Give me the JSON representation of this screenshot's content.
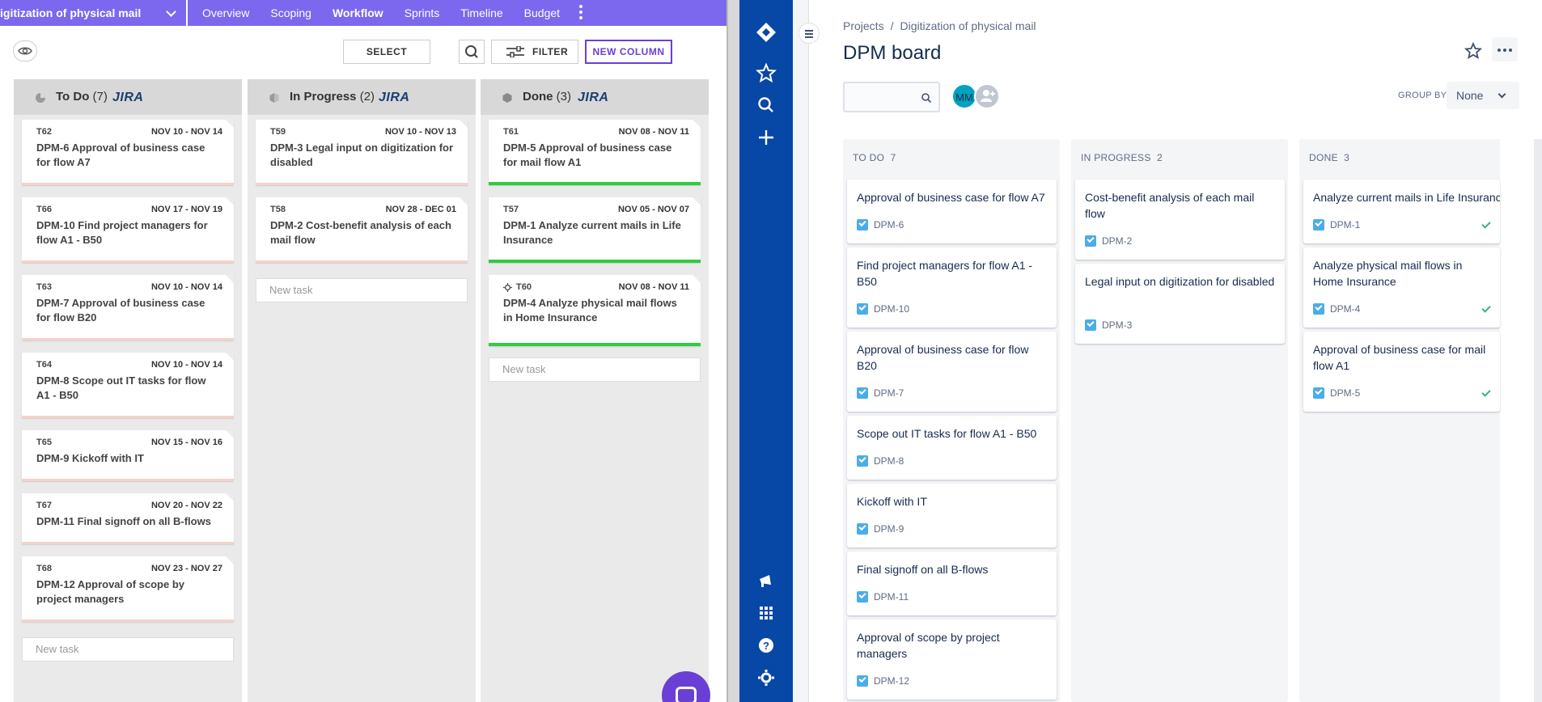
{
  "left_app": {
    "project_name": "igitization of physical mail",
    "nav": [
      "Overview",
      "Scoping",
      "Workflow",
      "Sprints",
      "Timeline",
      "Budget"
    ],
    "active_nav": "Workflow",
    "toolbar": {
      "select_label": "SELECT",
      "filter_label": "FILTER",
      "new_column_label": "NEW COLUMN"
    },
    "new_task_placeholder": "New task",
    "jira_label": "JIRA",
    "columns": [
      {
        "name": "To Do",
        "count": "(7)",
        "cards": [
          {
            "id": "T62",
            "dates": "NOV 10 - NOV 14",
            "title": "DPM-6 Approval of business case for flow A7"
          },
          {
            "id": "T66",
            "dates": "NOV 17 - NOV 19",
            "title": "DPM-10 Find project managers for flow A1 - B50"
          },
          {
            "id": "T63",
            "dates": "NOV 10 - NOV 14",
            "title": "DPM-7 Approval of business case for flow B20"
          },
          {
            "id": "T64",
            "dates": "NOV 10 - NOV 14",
            "title": "DPM-8 Scope out IT tasks for flow A1 - B50"
          },
          {
            "id": "T65",
            "dates": "NOV 15 - NOV 16",
            "title": "DPM-9 Kickoff with IT"
          },
          {
            "id": "T67",
            "dates": "NOV 20 - NOV 22",
            "title": "DPM-11 Final signoff on all B-flows"
          },
          {
            "id": "T68",
            "dates": "NOV 23 - NOV 27",
            "title": "DPM-12 Approval of scope by project managers"
          }
        ]
      },
      {
        "name": "In Progress",
        "count": "(2)",
        "cards": [
          {
            "id": "T59",
            "dates": "NOV 10 - NOV 13",
            "title": "DPM-3 Legal input on digitization for disabled"
          },
          {
            "id": "T58",
            "dates": "NOV 28 - DEC 01",
            "title": "DPM-2 Cost-benefit analysis of each mail flow"
          }
        ]
      },
      {
        "name": "Done",
        "count": "(3)",
        "cards": [
          {
            "id": "T61",
            "dates": "NOV 08 - NOV 11",
            "title": "DPM-5 Approval of business case for mail flow A1"
          },
          {
            "id": "T57",
            "dates": "NOV 05 - NOV 07",
            "title": "DPM-1 Analyze current mails in Life Insurance"
          },
          {
            "id": "T60",
            "dates": "NOV 08 - NOV 11",
            "title": "DPM-4 Analyze physical mail flows in Home Insurance"
          }
        ]
      }
    ],
    "colors": {
      "accent": "#7b68ee",
      "todo_bar": "#f6d1cc",
      "done_bar": "#2ecc40"
    }
  },
  "jira": {
    "breadcrumb": [
      "Projects",
      "/",
      "Digitization of physical mail"
    ],
    "board_title": "DPM board",
    "avatar_initials": "MM",
    "group_by_label": "GROUP BY",
    "group_by_value": "None",
    "columns": [
      {
        "name": "TO DO",
        "count": "7",
        "cards": [
          {
            "title": "Approval of business case for flow A7",
            "key": "DPM-6"
          },
          {
            "title": "Find project managers for flow A1 - B50",
            "key": "DPM-10"
          },
          {
            "title": "Approval of business case for flow B20",
            "key": "DPM-7"
          },
          {
            "title": "Scope out IT tasks for flow A1 - B50",
            "key": "DPM-8"
          },
          {
            "title": "Kickoff with IT",
            "key": "DPM-9"
          },
          {
            "title": "Final signoff on all B-flows",
            "key": "DPM-11"
          },
          {
            "title": "Approval of scope by project managers",
            "key": "DPM-12"
          }
        ]
      },
      {
        "name": "IN PROGRESS",
        "count": "2",
        "cards": [
          {
            "title": "Cost-benefit analysis of each mail flow",
            "key": "DPM-2"
          },
          {
            "title": "Legal input on digitization for disabled",
            "key": "DPM-3"
          }
        ]
      },
      {
        "name": "DONE",
        "count": "3",
        "cards": [
          {
            "title": "Analyze current mails in Life Insurance",
            "key": "DPM-1"
          },
          {
            "title": "Analyze physical mail flows in Home Insurance",
            "key": "DPM-4"
          },
          {
            "title": "Approval of business case for mail flow A1",
            "key": "DPM-5"
          }
        ]
      }
    ],
    "colors": {
      "sidebar": "#0747a6",
      "avatar": "#00a3bf",
      "check": "#4bade8",
      "done_check": "#36b37e"
    }
  }
}
